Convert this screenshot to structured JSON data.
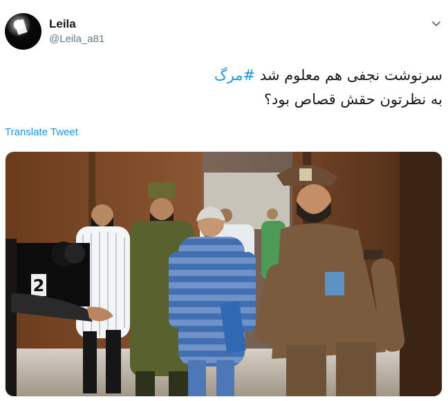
{
  "tweet": {
    "user": {
      "name": "Leila",
      "handle": "@Leila_a81"
    },
    "text_line_1_prefix": "سرنوشت نجفی هم معلوم شد ",
    "hashtag": "#مرگ",
    "text_line_2": "به نظرتون حقش قصاص بود؟",
    "translate_label": "Translate Tweet"
  },
  "photo": {
    "camera_number": "2"
  },
  "icons": {
    "menu": "chevron-down-icon"
  },
  "colors": {
    "link": "#1b95e0",
    "secondary_text": "#657786",
    "text": "#14171a"
  }
}
